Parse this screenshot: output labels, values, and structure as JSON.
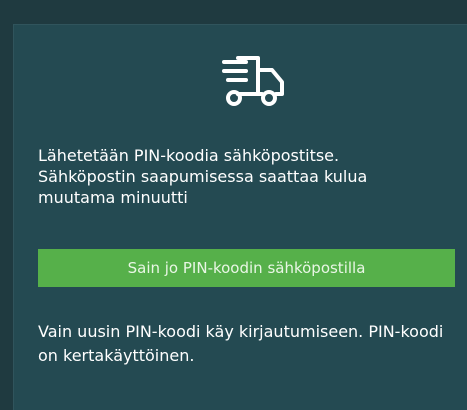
{
  "icon": "delivery-truck-icon",
  "message": "Lähetetään PIN-koodia sähköpostitse.\nSähköpostin saapumisessa saattaa kulua\nmuutama minuutti",
  "confirm_button_label": "Sain jo PIN-koodin sähköpostilla",
  "note": "Vain uusin PIN-koodi käy kirjautumiseen. PIN-koodi on kertakäyttöinen.",
  "colors": {
    "background": "#1f3a40",
    "panel": "#244a52",
    "button": "#56b04a",
    "text": "#ffffff"
  }
}
